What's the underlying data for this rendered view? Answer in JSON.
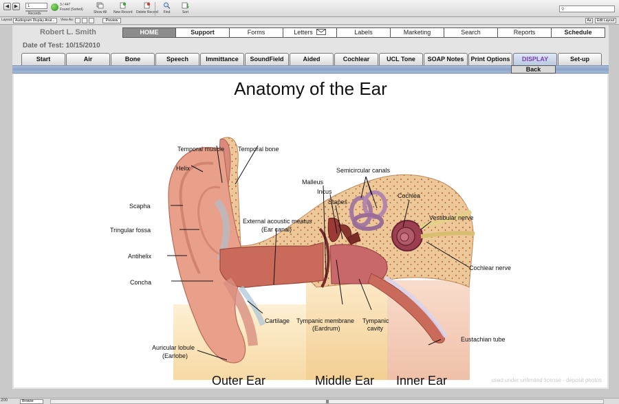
{
  "toolbar": {
    "record_input": "1",
    "records_label": "Records",
    "record_count": "3 / 447",
    "found_label": "Found (Sorted)",
    "tools": [
      {
        "label": "Show All",
        "icon": "show-all-icon"
      },
      {
        "label": "New Record",
        "icon": "new-record-icon"
      },
      {
        "label": "Delete Record",
        "icon": "delete-record-icon"
      },
      {
        "label": "Find",
        "icon": "find-icon"
      },
      {
        "label": "Sort",
        "icon": "sort-icon"
      }
    ]
  },
  "layoutbar": {
    "layout_label": "Layout:",
    "layout_value": "Audiogram Display Anat...",
    "view_as_label": "View As:",
    "preview_label": "Preview",
    "aa_label": "Aa",
    "edit_layout_label": "Edit Layout"
  },
  "header": {
    "patient_name": "Robert L. Smith",
    "test_date": "Date of Test: 10/15/2010"
  },
  "nav_primary": [
    {
      "label": "HOME",
      "active": true,
      "bold": true
    },
    {
      "label": "Support",
      "active": false,
      "bold": true
    },
    {
      "label": "Forms",
      "active": false,
      "bold": false
    },
    {
      "label": "Letters",
      "active": false,
      "bold": false
    },
    {
      "label": "Labels",
      "active": false,
      "bold": false
    },
    {
      "label": "Marketing",
      "active": false,
      "bold": false
    },
    {
      "label": "Search",
      "active": false,
      "bold": false
    },
    {
      "label": "Reports",
      "active": false,
      "bold": false
    },
    {
      "label": "Schedule",
      "active": false,
      "bold": true
    }
  ],
  "nav_secondary": [
    {
      "label": "Start"
    },
    {
      "label": "Air"
    },
    {
      "label": "Bone"
    },
    {
      "label": "Speech"
    },
    {
      "label": "Immittance"
    },
    {
      "label": "SoundField"
    },
    {
      "label": "Aided"
    },
    {
      "label": "Cochlear"
    },
    {
      "label": "UCL Tone"
    },
    {
      "label": "SOAP Notes"
    },
    {
      "label": "Print Options"
    },
    {
      "label": "DISPLAY",
      "active": true
    },
    {
      "label": "Set-up"
    }
  ],
  "back_label": "Back",
  "diagram": {
    "title": "Anatomy of the Ear",
    "labels": {
      "temporal_muscle": "Temporal muscle",
      "temporal_bone": "Temporal bone",
      "helix": "Helix",
      "semicircular_canals": "Semicircular canals",
      "malleus": "Malleus",
      "incus": "Incus",
      "stapes": "Stapes",
      "cochlea": "Cochlea",
      "scapha": "Scapha",
      "vestibular_nerve": "Vestibular nerve",
      "external_meatus_1": "External acoustic meatus",
      "external_meatus_2": "(Ear canal)",
      "tringular_fossa": "Tringular fossa",
      "antihelix": "Antihelix",
      "cochlear_nerve": "Cochlear nerve",
      "concha": "Concha",
      "cartilage": "Cartilage",
      "tympanic_membrane_1": "Tympanic membrane",
      "tympanic_membrane_2": "(Eardrum)",
      "tympanic_cavity_1": "Tympanic",
      "tympanic_cavity_2": "cavity",
      "eustachian_tube": "Eustachian tube",
      "auricular_lobule_1": "Auricular lobule",
      "auricular_lobule_2": "(Earlobe)"
    },
    "sections": {
      "outer": "Outer Ear",
      "middle": "Middle Ear",
      "inner": "Inner Ear"
    },
    "watermark": "used under unlimited license - deposit photos"
  },
  "bottombar": {
    "zoom": "200",
    "mode": "Browse"
  },
  "colors": {
    "nav_active": "#8c8c8c",
    "display_tab_text": "#7b3fb0",
    "band_blue": "#8aa3c8",
    "skin": "#e8a08a",
    "bone": "#e9cfa0",
    "canal": "#c96a5a"
  }
}
